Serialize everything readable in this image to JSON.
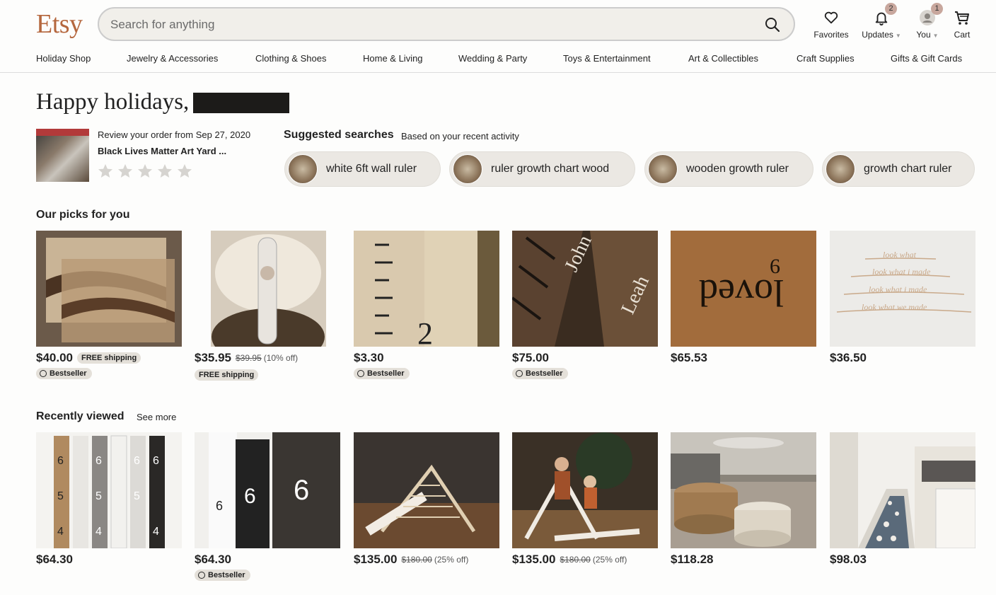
{
  "header": {
    "logo": "Etsy",
    "search_placeholder": "Search for anything",
    "favorites_label": "Favorites",
    "updates_label": "Updates",
    "updates_badge": "2",
    "you_label": "You",
    "you_badge": "1",
    "cart_label": "Cart"
  },
  "categories": [
    "Holiday Shop",
    "Jewelry & Accessories",
    "Clothing & Shoes",
    "Home & Living",
    "Wedding & Party",
    "Toys & Entertainment",
    "Art & Collectibles",
    "Craft Supplies",
    "Gifts & Gift Cards"
  ],
  "greeting": "Happy holidays,",
  "review": {
    "line": "Review your order from Sep 27, 2020",
    "title": "Black Lives Matter Art Yard ...",
    "stars": 5
  },
  "suggested": {
    "title": "Suggested searches",
    "subtitle": "Based on your recent activity",
    "items": [
      "white 6ft wall ruler",
      "ruler growth chart wood",
      "wooden growth ruler",
      "growth chart ruler"
    ]
  },
  "picks": {
    "title": "Our picks for you",
    "items": [
      {
        "price": "$40.00",
        "free": "FREE shipping",
        "best": "Bestseller"
      },
      {
        "price": "$35.95",
        "orig": "$39.95",
        "off": "(10% off)",
        "free2": "FREE shipping"
      },
      {
        "price": "$3.30",
        "best": "Bestseller"
      },
      {
        "price": "$75.00",
        "best": "Bestseller"
      },
      {
        "price": "$65.53"
      },
      {
        "price": "$36.50"
      }
    ]
  },
  "recent": {
    "title": "Recently viewed",
    "see_more": "See more",
    "items": [
      {
        "price": "$64.30"
      },
      {
        "price": "$64.30",
        "best": "Bestseller"
      },
      {
        "price": "$135.00",
        "orig": "$180.00",
        "off": "(25% off)"
      },
      {
        "price": "$135.00",
        "orig": "$180.00",
        "off": "(25% off)"
      },
      {
        "price": "$118.28"
      },
      {
        "price": "$98.03"
      }
    ]
  },
  "colors": {
    "brand": "#b5673e",
    "pill": "#ebe8e3",
    "badge": "#c8a79d"
  }
}
